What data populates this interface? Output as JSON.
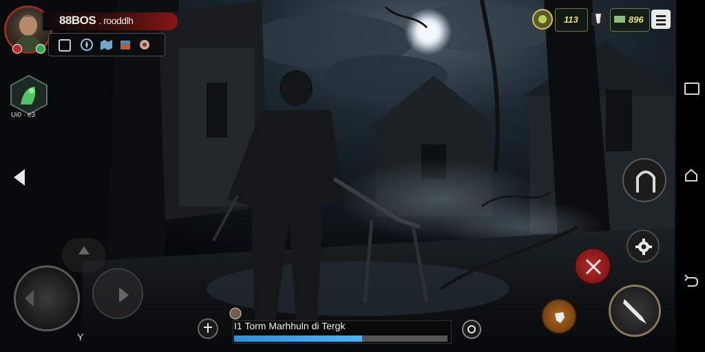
{
  "player": {
    "name": "88BOS",
    "subtitle": ". rooddlh"
  },
  "buff": {
    "label": "Ui0 · e3"
  },
  "resources": {
    "currency_1": "113",
    "currency_2": "896"
  },
  "quest": {
    "text": "I1 Torm Marhhuln di Tergk",
    "progress_pct": 60
  },
  "joystick": {
    "hint": "Y"
  },
  "colors": {
    "name_bar": "#8a1616",
    "quest_fill": "#3aa0e8",
    "avatar_ring": "#9a2a24"
  }
}
